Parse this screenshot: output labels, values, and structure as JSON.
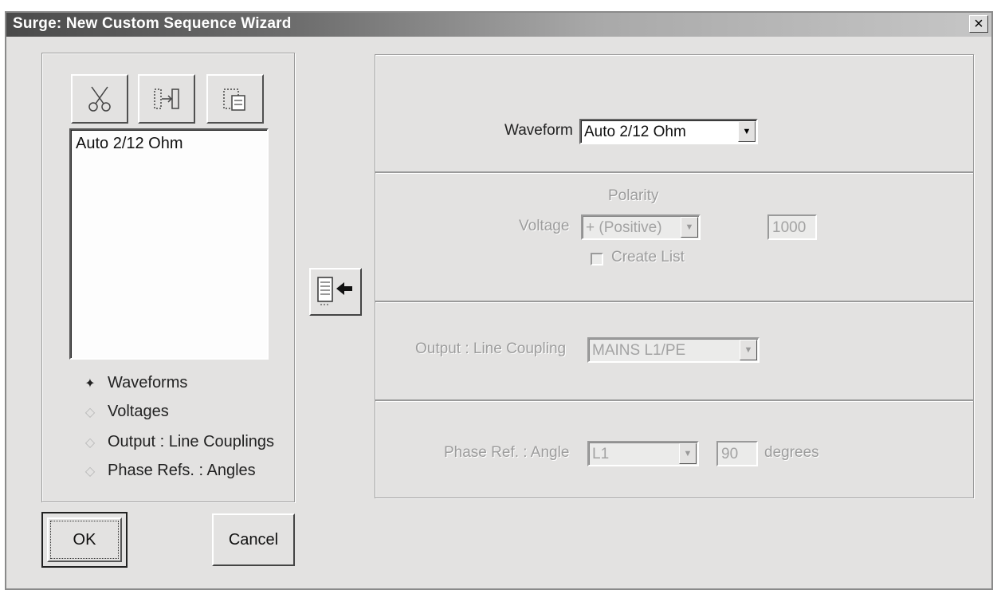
{
  "window": {
    "title": "Surge: New Custom Sequence Wizard",
    "close_symbol": "×"
  },
  "toolbar": {
    "buttons": [
      {
        "name": "cut",
        "icon": "scissors-icon"
      },
      {
        "name": "insert",
        "icon": "insert-between-icon"
      },
      {
        "name": "paste",
        "icon": "paste-icon"
      }
    ]
  },
  "sequence_list": {
    "items": [
      "Auto 2/12 Ohm"
    ]
  },
  "steps": [
    {
      "label": "Waveforms",
      "state": "active"
    },
    {
      "label": "Voltages",
      "state": "inactive"
    },
    {
      "label": "Output : Line Couplings",
      "state": "inactive"
    },
    {
      "label": "Phase Refs. : Angles",
      "state": "inactive"
    }
  ],
  "buttons": {
    "ok": "OK",
    "cancel": "Cancel",
    "add_to_list_icon": "add-to-list-icon"
  },
  "waveform": {
    "label": "Waveform",
    "value": "Auto 2/12 Ohm"
  },
  "voltage": {
    "polarity_heading": "Polarity",
    "label": "Voltage",
    "polarity_value": "+ (Positive)",
    "amount": "1000",
    "create_list_label": "Create List",
    "create_list_checked": false
  },
  "coupling": {
    "label": "Output : Line Coupling",
    "value": "MAINS L1/PE"
  },
  "phase": {
    "label": "Phase Ref. : Angle",
    "ref_value": "L1",
    "angle": "90",
    "unit": "degrees"
  },
  "colors": {
    "dialog_bg": "#e3e2e1",
    "disabled_text": "#9c9c9c",
    "title_gradient_start": "#4a4a4a",
    "title_gradient_end": "#c6c6c6"
  }
}
